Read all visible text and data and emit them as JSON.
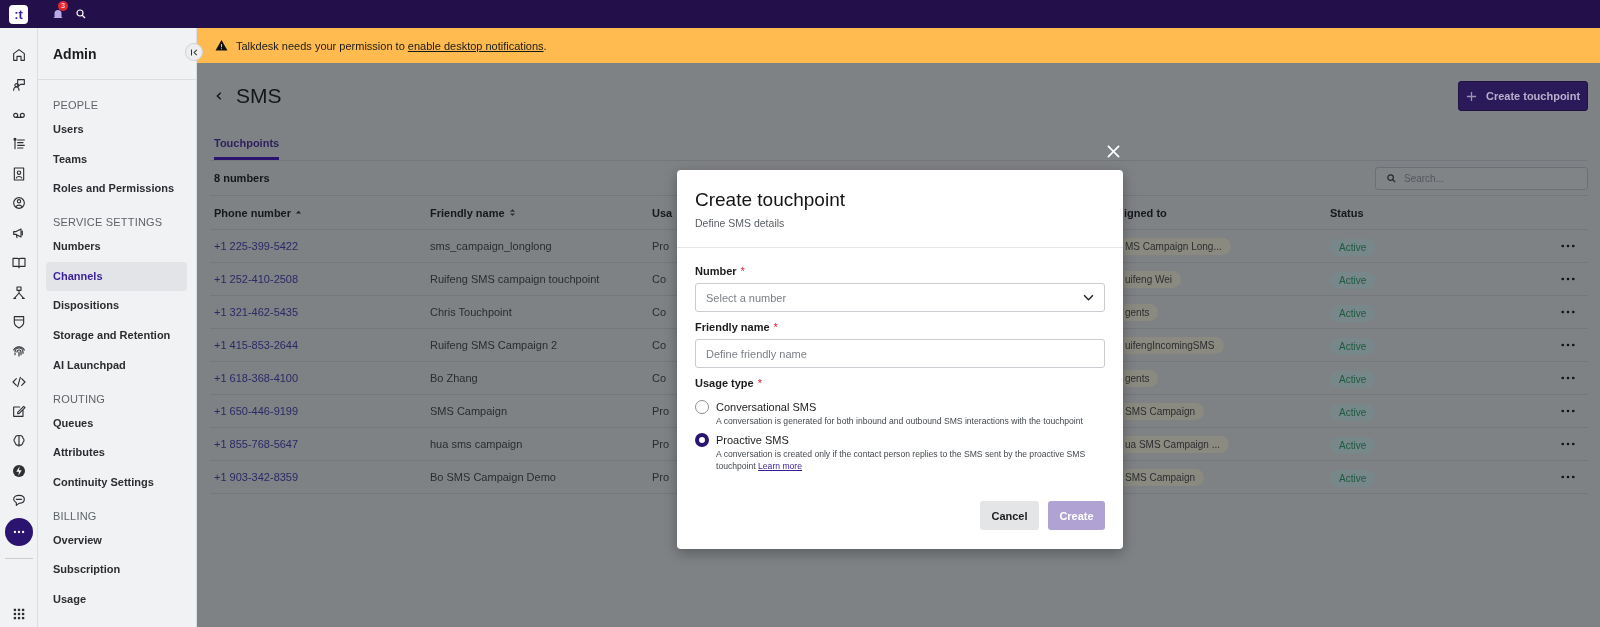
{
  "top_bar": {
    "logo_text": ":t",
    "notification_count": "3"
  },
  "sidebar": {
    "title": "Admin",
    "sections": [
      {
        "heading": "PEOPLE",
        "items": [
          {
            "label": "Users",
            "selected": false
          },
          {
            "label": "Teams",
            "selected": false
          },
          {
            "label": "Roles and Permissions",
            "selected": false
          }
        ]
      },
      {
        "heading": "SERVICE SETTINGS",
        "items": [
          {
            "label": "Numbers",
            "selected": false
          },
          {
            "label": "Channels",
            "selected": true
          },
          {
            "label": "Dispositions",
            "selected": false
          },
          {
            "label": "Storage and Retention",
            "selected": false
          },
          {
            "label": "AI Launchpad",
            "selected": false
          }
        ]
      },
      {
        "heading": "ROUTING",
        "items": [
          {
            "label": "Queues",
            "selected": false
          },
          {
            "label": "Attributes",
            "selected": false
          },
          {
            "label": "Continuity Settings",
            "selected": false
          }
        ]
      },
      {
        "heading": "BILLING",
        "items": [
          {
            "label": "Overview",
            "selected": false
          },
          {
            "label": "Subscription",
            "selected": false
          },
          {
            "label": "Usage",
            "selected": false
          }
        ]
      }
    ]
  },
  "banner": {
    "text": "Talkdesk needs your permission to ",
    "link": "enable desktop notifications",
    "text_after": "."
  },
  "page": {
    "title": "SMS",
    "create_button": "Create touchpoint",
    "tabs": [
      {
        "label": "Touchpoints",
        "selected": true
      }
    ],
    "count": "8 numbers",
    "search": {
      "placeholder": "Search..."
    }
  },
  "table": {
    "columns": [
      {
        "label": "Phone number",
        "sorted": true
      },
      {
        "label": "Friendly name",
        "sorted": false
      },
      {
        "label": "Usa"
      },
      {
        "label": "igned to"
      },
      {
        "label": "Status"
      }
    ],
    "rows": [
      {
        "phone": "+1 225-399-5422",
        "friendly_name": "sms_campaign_longlong",
        "usage_type": "Pro",
        "assigned_to": "MS Campaign Long...",
        "status": "Active"
      },
      {
        "phone": "+1 252-410-2508",
        "friendly_name": "Ruifeng SMS campaign touchpoint",
        "usage_type": "Co",
        "assigned_to": "uifeng Wei",
        "status": "Active"
      },
      {
        "phone": "+1 321-462-5435",
        "friendly_name": "Chris Touchpoint",
        "usage_type": "Co",
        "assigned_to": "gents",
        "status": "Active"
      },
      {
        "phone": "+1 415-853-2644",
        "friendly_name": "Ruifeng SMS Campaign 2",
        "usage_type": "Co",
        "assigned_to": "uifengIncomingSMS",
        "status": "Active"
      },
      {
        "phone": "+1 618-368-4100",
        "friendly_name": "Bo Zhang",
        "usage_type": "Co",
        "assigned_to": "gents",
        "status": "Active"
      },
      {
        "phone": "+1 650-446-9199",
        "friendly_name": "SMS Campaign",
        "usage_type": "Pro",
        "assigned_to": "SMS Campaign",
        "status": "Active"
      },
      {
        "phone": "+1 855-768-5647",
        "friendly_name": "hua sms campaign",
        "usage_type": "Pro",
        "assigned_to": "ua SMS Campaign ...",
        "status": "Active"
      },
      {
        "phone": "+1 903-342-8359",
        "friendly_name": "Bo SMS Campaign Demo",
        "usage_type": "Pro",
        "assigned_to": "SMS Campaign",
        "status": "Active"
      }
    ]
  },
  "modal": {
    "title": "Create touchpoint",
    "subtitle": "Define SMS details",
    "fields": [
      {
        "kind": "select",
        "label": "Number",
        "required_mark": "*",
        "placeholder": "Select a number"
      },
      {
        "kind": "text",
        "label": "Friendly name",
        "required_mark": "*",
        "placeholder": "Define friendly name"
      }
    ],
    "usage_type": {
      "label": "Usage type",
      "required_mark": "*",
      "options": [
        {
          "label": "Conversational SMS",
          "description": "A conversation is generated for both inbound and outbound SMS interactions with the touchpoint",
          "selected": false
        },
        {
          "label": "Proactive SMS",
          "description": "A conversation is created only if the contact person replies to the SMS sent by the proactive SMS touchpoint ",
          "link": "Learn more",
          "selected": true
        }
      ]
    },
    "buttons": [
      {
        "label": "Cancel",
        "kind": "secondary",
        "disabled": false
      },
      {
        "label": "Create",
        "kind": "primary",
        "disabled": true
      }
    ]
  }
}
